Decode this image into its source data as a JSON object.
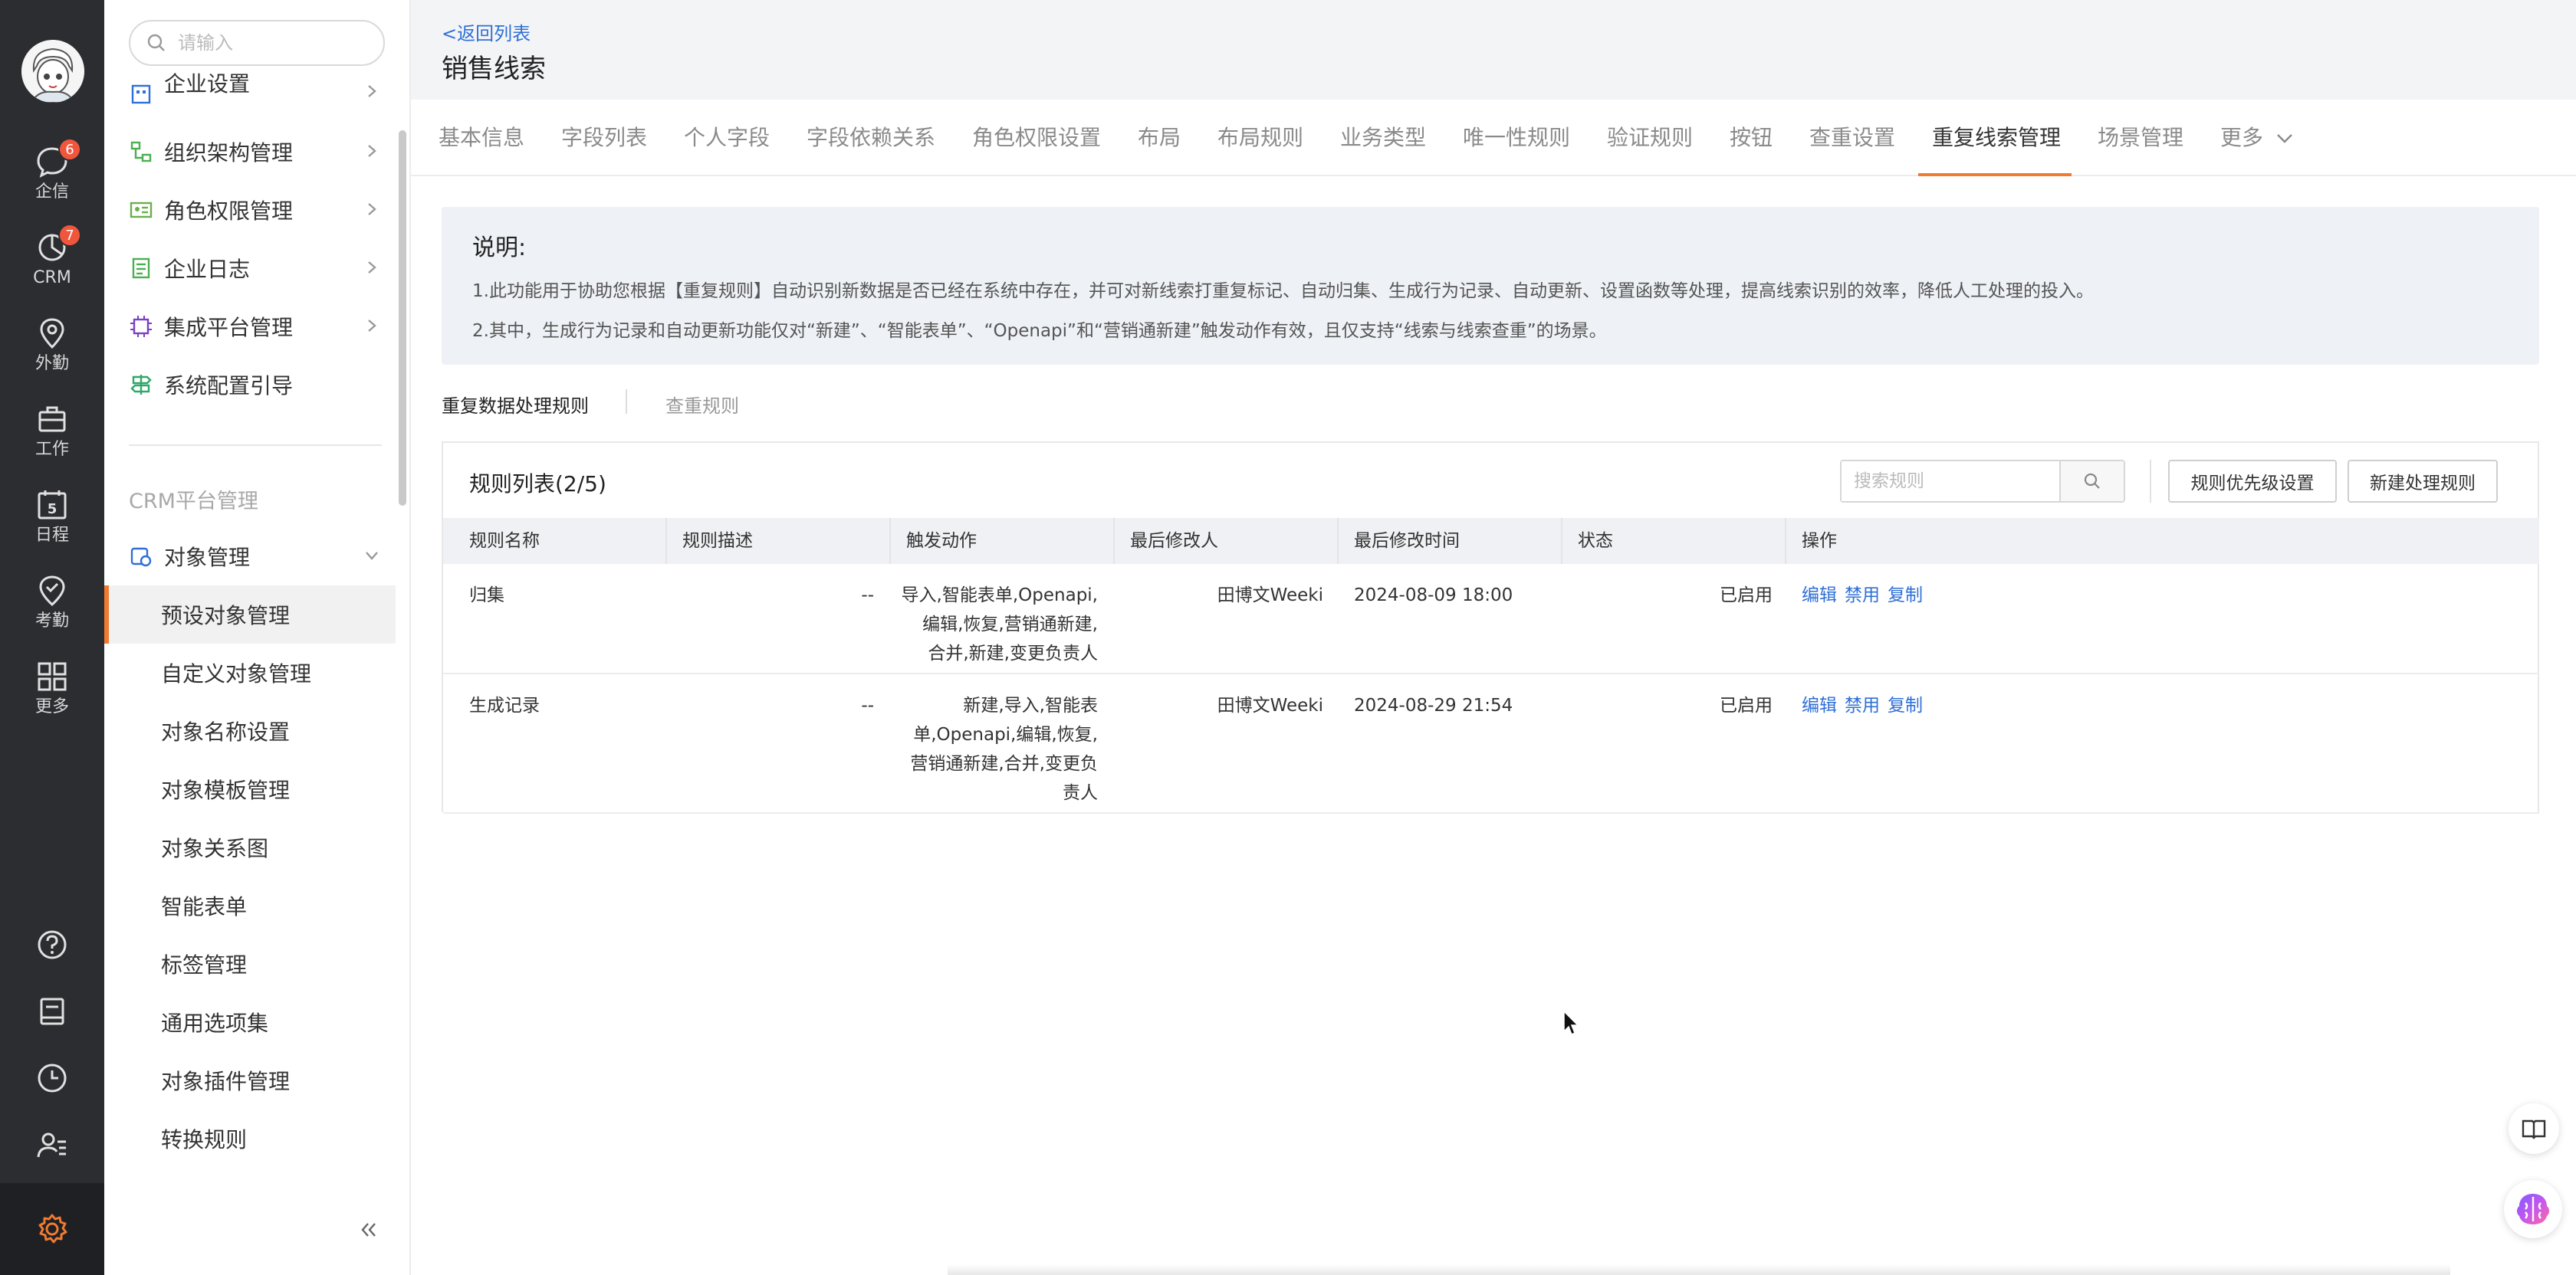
{
  "rail": {
    "items": [
      {
        "label": "企信",
        "icon": "chat-bubble-icon",
        "badge": "6"
      },
      {
        "label": "CRM",
        "icon": "pie-chart-icon",
        "badge": "7"
      },
      {
        "label": "外勤",
        "icon": "map-pin-icon"
      },
      {
        "label": "工作",
        "icon": "briefcase-icon"
      },
      {
        "label": "日程",
        "icon": "calendar-icon",
        "day": "5"
      },
      {
        "label": "考勤",
        "icon": "check-location-icon"
      },
      {
        "label": "更多",
        "icon": "grid-icon"
      }
    ],
    "accent": "#f07b30"
  },
  "sidebar": {
    "search_placeholder": "请输入",
    "items_top": [
      {
        "label": "企业设置"
      },
      {
        "label": "组织架构管理"
      },
      {
        "label": "角色权限管理"
      },
      {
        "label": "企业日志"
      },
      {
        "label": "集成平台管理"
      },
      {
        "label": "系统配置引导"
      }
    ],
    "section": "CRM平台管理",
    "object_manage": "对象管理",
    "sub_items": [
      {
        "label": "预设对象管理"
      },
      {
        "label": "自定义对象管理"
      },
      {
        "label": "对象名称设置"
      },
      {
        "label": "对象模板管理"
      },
      {
        "label": "对象关系图"
      },
      {
        "label": "智能表单"
      },
      {
        "label": "标签管理"
      },
      {
        "label": "通用选项集"
      },
      {
        "label": "对象插件管理"
      },
      {
        "label": "转换规则"
      }
    ]
  },
  "header": {
    "back": "<返回列表",
    "title": "销售线索"
  },
  "tabs": [
    {
      "label": "基本信息"
    },
    {
      "label": "字段列表"
    },
    {
      "label": "个人字段"
    },
    {
      "label": "字段依赖关系"
    },
    {
      "label": "角色权限设置"
    },
    {
      "label": "布局"
    },
    {
      "label": "布局规则"
    },
    {
      "label": "业务类型"
    },
    {
      "label": "唯一性规则"
    },
    {
      "label": "验证规则"
    },
    {
      "label": "按钮"
    },
    {
      "label": "查重设置"
    },
    {
      "label": "重复线索管理"
    },
    {
      "label": "场景管理"
    },
    {
      "label": "更多"
    }
  ],
  "description": {
    "title": "说明:",
    "line1": "1.此功能用于协助您根据【重复规则】自动识别新数据是否已经在系统中存在，并可对新线索打重复标记、自动归集、生成行为记录、自动更新、设置函数等处理，提高线索识别的效率，降低人工处理的投入。",
    "line2": "2.其中，生成行为记录和自动更新功能仅对“新建”、“智能表单”、“Openapi”和“营销通新建”触发动作有效，且仅支持“线索与线索查重”的场景。"
  },
  "subtabs": {
    "active": "重复数据处理规则",
    "inactive": "查重规则"
  },
  "panel": {
    "title": "规则列表(2/5)",
    "search_placeholder": "搜索规则",
    "priority_btn": "规则优先级设置",
    "new_btn": "新建处理规则"
  },
  "table": {
    "headers": [
      "规则名称",
      "规则描述",
      "触发动作",
      "最后修改人",
      "最后修改时间",
      "状态",
      "操作"
    ],
    "rows": [
      {
        "name": "归集",
        "desc": "--",
        "trigger_lines": [
          "导入,智能表单,Openapi,",
          "编辑,恢复,营销通新建,",
          "合并,新建,变更负责人"
        ],
        "modifier": "田博文Weeki",
        "time": "2024-08-09 18:00",
        "status": "已启用",
        "ops": [
          "编辑",
          "禁用",
          "复制"
        ]
      },
      {
        "name": "生成记录",
        "desc": "--",
        "trigger_lines": [
          "新建,导入,智能表",
          "单,Openapi,编辑,恢复,",
          "营销通新建,合并,变更负",
          "责人"
        ],
        "modifier": "田博文Weeki",
        "time": "2024-08-29 21:54",
        "status": "已启用",
        "ops": [
          "编辑",
          "禁用",
          "复制"
        ]
      }
    ]
  }
}
